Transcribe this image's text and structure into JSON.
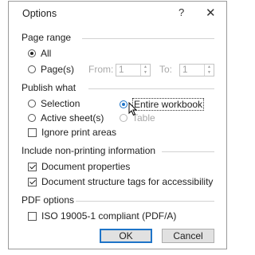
{
  "dialog": {
    "title": "Options",
    "help_label": "?",
    "close_label": "✕"
  },
  "page_range": {
    "title": "Page range",
    "all_label": "All",
    "pages_label": "Page(s)",
    "from_label": "From:",
    "from_value": "1",
    "to_label": "To:",
    "to_value": "1",
    "selected": "All"
  },
  "publish_what": {
    "title": "Publish what",
    "selection_label": "Selection",
    "entire_workbook_label": "Entire workbook",
    "active_sheets_label": "Active sheet(s)",
    "table_label": "Table",
    "ignore_print_areas_label": "Ignore print areas",
    "selected": "Entire workbook",
    "ignore_print_areas_checked": false
  },
  "non_printing": {
    "title": "Include non-printing information",
    "document_properties_label": "Document properties",
    "structure_tags_label": "Document structure tags for accessibility",
    "document_properties_checked": true,
    "structure_tags_checked": true
  },
  "pdf_options": {
    "title": "PDF options",
    "iso_label": "ISO 19005-1 compliant (PDF/A)",
    "iso_checked": false
  },
  "buttons": {
    "ok_label": "OK",
    "cancel_label": "Cancel"
  },
  "colors": {
    "accent": "#1e74c8",
    "rule": "#d2d2d2",
    "disabled_text": "#a8a8a8"
  }
}
